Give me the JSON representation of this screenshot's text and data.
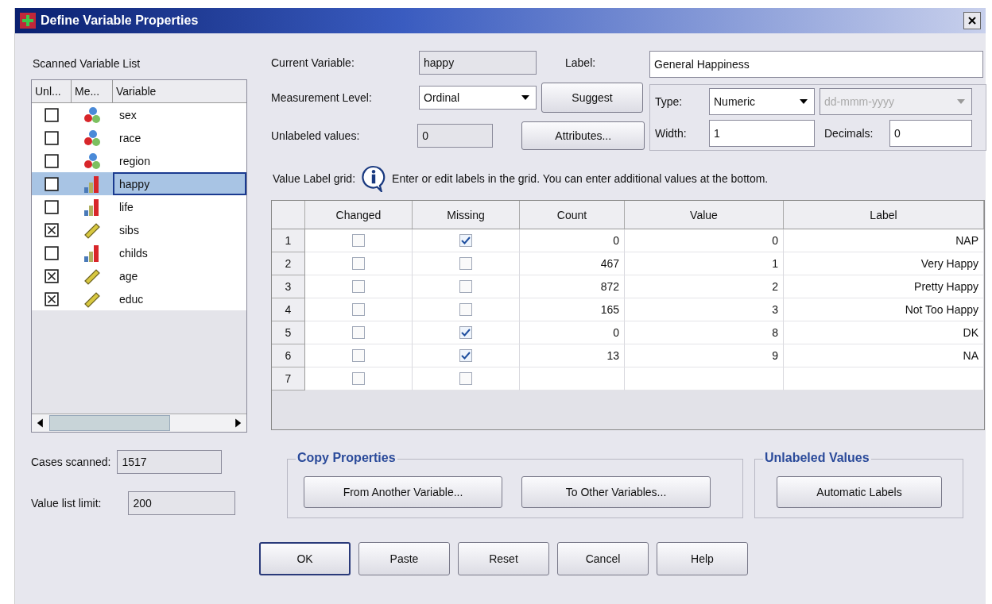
{
  "window": {
    "title": "Define Variable Properties"
  },
  "scanned_list": {
    "title": "Scanned Variable List",
    "columns": [
      "Unl...",
      "Me...",
      "Variable"
    ],
    "items": [
      {
        "name": "sex",
        "kind": "nominal",
        "checked": false,
        "selected": false
      },
      {
        "name": "race",
        "kind": "nominal",
        "checked": false,
        "selected": false
      },
      {
        "name": "region",
        "kind": "nominal",
        "checked": false,
        "selected": false
      },
      {
        "name": "happy",
        "kind": "ordinal",
        "checked": false,
        "selected": true
      },
      {
        "name": "life",
        "kind": "ordinal",
        "checked": false,
        "selected": false
      },
      {
        "name": "sibs",
        "kind": "scale",
        "checked": true,
        "selected": false
      },
      {
        "name": "childs",
        "kind": "ordinal",
        "checked": false,
        "selected": false
      },
      {
        "name": "age",
        "kind": "scale",
        "checked": true,
        "selected": false
      },
      {
        "name": "educ",
        "kind": "scale",
        "checked": true,
        "selected": false
      }
    ]
  },
  "cases_scanned": {
    "label": "Cases scanned:",
    "value": "1517"
  },
  "value_list_limit": {
    "label": "Value list limit:",
    "value": "200"
  },
  "current_variable": {
    "label": "Current Variable:",
    "value": "happy"
  },
  "label_field": {
    "label": "Label:",
    "value": "General Happiness"
  },
  "measurement_level": {
    "label": "Measurement Level:",
    "value": "Ordinal"
  },
  "suggest_button": "Suggest",
  "unlabeled_values": {
    "label": "Unlabeled values:",
    "value": "0"
  },
  "attributes_button": "Attributes...",
  "type": {
    "label": "Type:",
    "value": "Numeric",
    "format": "dd-mmm-yyyy"
  },
  "width": {
    "label": "Width:",
    "value": "1"
  },
  "decimals": {
    "label": "Decimals:",
    "value": "0"
  },
  "value_label_grid": {
    "label": "Value Label grid:",
    "hint": "Enter or edit labels in the grid. You can enter additional values at the bottom.",
    "columns": [
      "Changed",
      "Missing",
      "Count",
      "Value",
      "Label"
    ],
    "rows": [
      {
        "row": "1",
        "changed": false,
        "missing": true,
        "count": "0",
        "value": "0",
        "label": "NAP"
      },
      {
        "row": "2",
        "changed": false,
        "missing": false,
        "count": "467",
        "value": "1",
        "label": "Very Happy"
      },
      {
        "row": "3",
        "changed": false,
        "missing": false,
        "count": "872",
        "value": "2",
        "label": "Pretty Happy"
      },
      {
        "row": "4",
        "changed": false,
        "missing": false,
        "count": "165",
        "value": "3",
        "label": "Not Too Happy"
      },
      {
        "row": "5",
        "changed": false,
        "missing": true,
        "count": "0",
        "value": "8",
        "label": "DK"
      },
      {
        "row": "6",
        "changed": false,
        "missing": true,
        "count": "13",
        "value": "9",
        "label": "NA"
      },
      {
        "row": "7",
        "changed": false,
        "missing": false
      }
    ]
  },
  "copy_properties": {
    "title": "Copy Properties",
    "buttons": [
      "From Another Variable...",
      "To Other Variables..."
    ]
  },
  "unlabeled_group": {
    "title": "Unlabeled Values",
    "button": "Automatic Labels"
  },
  "buttons": [
    "OK",
    "Paste",
    "Reset",
    "Cancel",
    "Help"
  ]
}
